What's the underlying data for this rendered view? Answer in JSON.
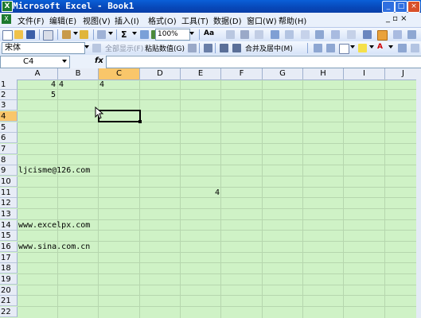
{
  "window": {
    "title": "Microsoft Excel - Book1",
    "app_icon": "X",
    "buttons": {
      "minimize": "_",
      "maximize": "□",
      "close": "×"
    }
  },
  "menubar": {
    "items": [
      "文件(F)",
      "编辑(E)",
      "视图(V)",
      "插入(I)",
      "格式(O)",
      "工具(T)",
      "数据(D)",
      "窗口(W)",
      "帮助(H)"
    ],
    "right": "_ ▫ ×"
  },
  "toolbar1": {
    "zoom": "100%",
    "sigma": "Σ"
  },
  "toolbar2": {
    "font_name": "宋体",
    "paste_values": "粘贴数值(G)",
    "merge_center": "合并及居中(M)"
  },
  "formula_bar": {
    "cell_ref": "C4",
    "fx": "fx",
    "formula": ""
  },
  "columns": [
    "A",
    "B",
    "C",
    "D",
    "E",
    "F",
    "G",
    "H",
    "I",
    "J"
  ],
  "selected_column": "C",
  "rows": [
    "1",
    "2",
    "3",
    "4",
    "5",
    "6",
    "7",
    "8",
    "9",
    "10",
    "11",
    "12",
    "13",
    "14",
    "15",
    "16",
    "17",
    "18",
    "19",
    "20",
    "21",
    "22"
  ],
  "selected_row": "4",
  "cells": {
    "A1": "4",
    "B1": "4",
    "C1": "4",
    "A2": "5",
    "A9": "ljcisme@126.com",
    "E11": "4",
    "A14": "www.excelpx.com",
    "A16": "www.sina.com.cn"
  },
  "colors": {
    "sheet_background": "#cff2c6",
    "selected_header": "#f9c66a",
    "title_bar": "#0747b8"
  }
}
